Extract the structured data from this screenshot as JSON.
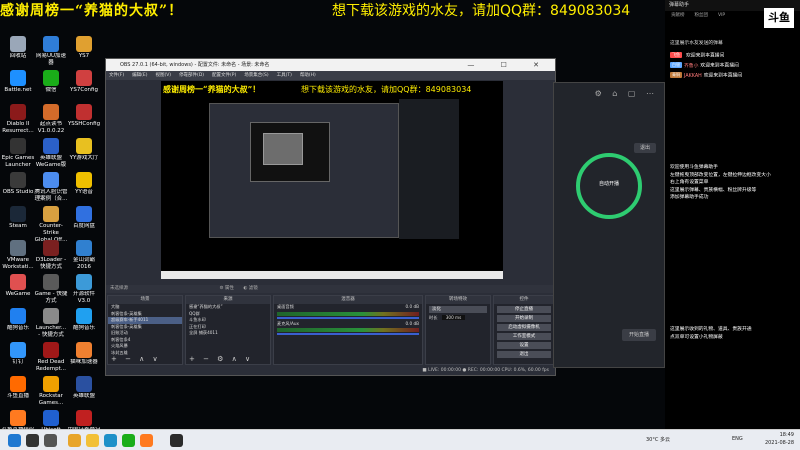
{
  "banner": {
    "left_text": "感谢周榜一“养猫的大叔”！",
    "right_text": "想下载该游戏的水友，请加QQ群：849083034"
  },
  "desktop_icons": [
    {
      "label": "回收站",
      "color": "#9aa7b8"
    },
    {
      "label": "网易UU加速器",
      "color": "#2f7dd8"
    },
    {
      "label": "YS7",
      "color": "#e0a030"
    },
    {
      "label": "Battle.net",
      "color": "#1e90ff"
    },
    {
      "label": "微信",
      "color": "#1aad19"
    },
    {
      "label": "YS7Config",
      "color": "#d04040"
    },
    {
      "label": "Diablo II Resurrect...",
      "color": "#8b1a1a"
    },
    {
      "label": "起点读书V1.0.0.22",
      "color": "#d36b2a"
    },
    {
      "label": "YSSHConfig",
      "color": "#c03030"
    },
    {
      "label": "Epic Games Launcher",
      "color": "#333333"
    },
    {
      "label": "英雄联盟WeGame版",
      "color": "#2b60c8"
    },
    {
      "label": "YY游戏大厅",
      "color": "#e8c020"
    },
    {
      "label": "OBS Studio",
      "color": "#3a3a3a"
    },
    {
      "label": "腾讯人脸识管理案例（合...",
      "color": "#4c8df0"
    },
    {
      "label": "YY语音",
      "color": "#f0c000"
    },
    {
      "label": "Steam",
      "color": "#1b2838"
    },
    {
      "label": "Counter-Strike Global Off...",
      "color": "#d8a040"
    },
    {
      "label": "百度网盘",
      "color": "#3070e0"
    },
    {
      "label": "VMware Workstati...",
      "color": "#607080"
    },
    {
      "label": "D3Loader - 快捷方式",
      "color": "#7a2020"
    },
    {
      "label": "金山词霸2016",
      "color": "#3080d0"
    },
    {
      "label": "WeGame",
      "color": "#e05050"
    },
    {
      "label": "Game - 快捷方式",
      "color": "#5a5a5a"
    },
    {
      "label": "开源软件V3.0",
      "color": "#3c9ad8"
    },
    {
      "label": "酷狗音乐",
      "color": "#2080f0"
    },
    {
      "label": "Launcher... - 快捷方式",
      "color": "#8a8a8a"
    },
    {
      "label": "酷狗音乐",
      "color": "#20a0f0"
    },
    {
      "label": "钉钉",
      "color": "#3296fa"
    },
    {
      "label": "Red Dead Redempt...",
      "color": "#a01818"
    },
    {
      "label": "猫咪加速器",
      "color": "#f08030"
    },
    {
      "label": "斗鱼直播",
      "color": "#ff6a00"
    },
    {
      "label": "Rockstar Games...",
      "color": "#f0a000"
    },
    {
      "label": "英雄联盟",
      "color": "#2a50a0"
    },
    {
      "label": "斗鱼直播伴侣",
      "color": "#ff7a20"
    },
    {
      "label": "Ubisoft Connect",
      "color": "#2060d0"
    },
    {
      "label": "中国证券登记结算...",
      "color": "#c02020"
    }
  ],
  "obs": {
    "title": "OBS 27.0.1 (64-bit, windows) - 配置文件: 未命名 - 场景: 未命名",
    "menu": [
      "文件(F)",
      "编辑(E)",
      "视图(V)",
      "停靠部件(D)",
      "配置文件(P)",
      "场景集合(S)",
      "工具(T)",
      "帮助(H)"
    ],
    "window_controls": "— ☐ ✕",
    "preview_banner_left": "感谢周榜一“养猫的大叔”！",
    "preview_banner_right": "想下载该游戏的水友，请加QQ群：849083034",
    "dock_label": "未选择源",
    "dock_buttons": [
      "属性",
      "滤镜"
    ],
    "panels": {
      "scenes": {
        "title": "场景",
        "items": [
          "大脑",
          "刺客信条-英雄集",
          "超级赛车-新手4011",
          "刺客信条-英雄集",
          "旧账活动",
          "刺客信条4",
          "火焰风暴",
          "冰封五雄"
        ]
      },
      "sources": {
        "title": "来源",
        "items": [
          "感谢“养猫的大叔”",
          "QQ群",
          "斗鱼水印",
          "正在打印",
          "全屏 捕获4011"
        ]
      },
      "mixer": {
        "title": "混音器",
        "channels": [
          {
            "name": "桌面音频",
            "level": "0.0 dB"
          },
          {
            "name": "麦克风/Aux",
            "level": "0.0 dB"
          }
        ]
      },
      "transitions": {
        "title": "转场特效",
        "type": "淡化",
        "duration_label": "时长",
        "duration": "300 ms"
      },
      "controls": {
        "title": "控件",
        "buttons": [
          "停止直播",
          "开始录制",
          "启动虚拟摄像机",
          "工作室模式",
          "设置",
          "退出"
        ]
      }
    },
    "statusbar": "■ LIVE: 00:00:00   ● REC: 00:00:00   CPU: 0.6%, 60.00 fps"
  },
  "douyu_app": {
    "logo": "斗鱼",
    "exit_label": "退出",
    "ring_label": "自动开播",
    "start_label": "开始直播"
  },
  "right_panel": {
    "header": "弹幕助手",
    "tabs": [
      "贡献榜",
      "粉丝团",
      "VIP"
    ],
    "logo": "斗鱼",
    "notice_top": "这里展示水友发送的弹幕",
    "messages": [
      {
        "badge": "飞鱼",
        "badge_color": "#ff4d4d",
        "user": "",
        "text": "欢迎来到本直播间"
      },
      {
        "badge": "白银",
        "badge_color": "#5fa8ff",
        "user": "齐鲁小",
        "text": "欢迎来到本直播间"
      },
      {
        "badge": "青铜",
        "badge_color": "#c07a3a",
        "user": "JAKKAH",
        "text": "欢迎来到本直播间"
      }
    ],
    "help_lines": [
      "欢迎使用斗鱼弹幕助手",
      "左键拖曳顶部改变位置，左键拉伸边框改变大小",
      "右上角有设置菜单",
      "这里展示弹幕、贵族横幅、粉丝牌升级等",
      "添加弹幕助手成功"
    ],
    "gift_notice": [
      "这里展示收到的礼物、道具、贵族开通",
      "点双单可设置小礼物屏蔽"
    ]
  },
  "taskbar": {
    "weather": "30°C 多云",
    "lang": "ENG",
    "time": "18:49",
    "date": "2021-08-28",
    "apps": [
      {
        "name": "windows-start",
        "color": "#1f78d1"
      },
      {
        "name": "search",
        "color": "#333333"
      },
      {
        "name": "task-view",
        "color": "#555555"
      },
      {
        "name": "chrome",
        "color": "#e8a52a"
      },
      {
        "name": "file-explorer",
        "color": "#f2c037"
      },
      {
        "name": "edge",
        "color": "#1e90c8"
      },
      {
        "name": "wechat",
        "color": "#1aad19"
      },
      {
        "name": "douyu",
        "color": "#ff7a20"
      },
      {
        "name": "obs",
        "color": "#2b2b2b"
      }
    ]
  }
}
